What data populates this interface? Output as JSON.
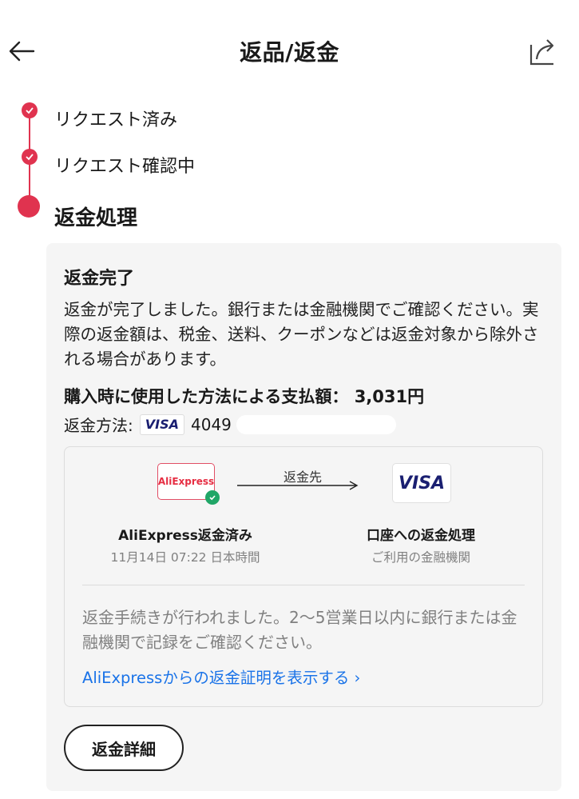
{
  "header": {
    "title": "返品/返金"
  },
  "steps": [
    {
      "label": "リクエスト済み",
      "status": "done"
    },
    {
      "label": "リクエスト確認中",
      "status": "done"
    },
    {
      "label": "返金処理",
      "status": "current"
    }
  ],
  "card": {
    "title": "返金完了",
    "description": "返金が完了しました。銀行または金融機関でご確認ください。実際の返金額は、税金、送料、クーポンなどは返金対象から除外される場合があります。",
    "paid_label": "購入時に使用した方法による支払額：",
    "paid_amount": "3,031円",
    "method_label": "返金方法:",
    "visa_badge": "VISA",
    "card_number": "4049",
    "flow": {
      "from_logo": "AliExpress",
      "arrow_label": "返金先",
      "to_logo": "VISA",
      "from_title": "AliExpress返金済み",
      "from_sub": "11月14日 07:22 日本時間",
      "to_title": "口座への返金処理",
      "to_sub": "ご利用の金融機関"
    },
    "note": "返金手続きが行われました。2〜5営業日以内に銀行または金融機関で記録をご確認ください。",
    "proof_link": "AliExpressからの返金証明を表示する ›",
    "detail_button": "返金詳細"
  },
  "colors": {
    "accent": "#e0334f",
    "link": "#1a73e8",
    "success": "#20a667",
    "visa": "#1a1f71"
  }
}
